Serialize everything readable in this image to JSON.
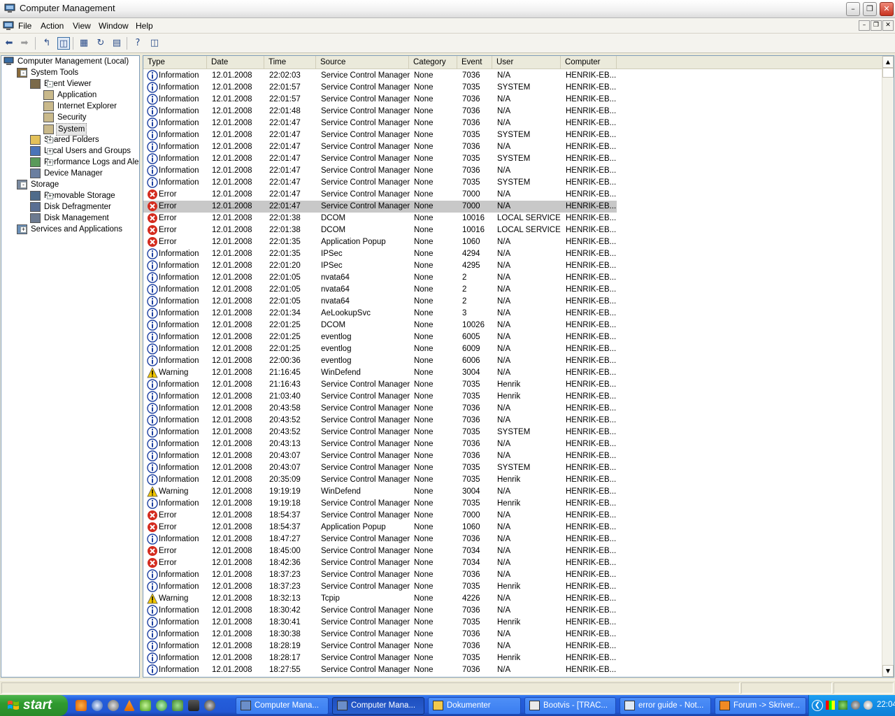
{
  "window": {
    "title": "Computer Management"
  },
  "menu": [
    "File",
    "Action",
    "View",
    "Window",
    "Help"
  ],
  "tree": {
    "root": "Computer Management (Local)",
    "items": [
      {
        "label": "System Tools",
        "level": 1,
        "exp": "-",
        "icon": "tools-icon"
      },
      {
        "label": "Event Viewer",
        "level": 2,
        "exp": "-",
        "icon": "event-viewer-icon"
      },
      {
        "label": "Application",
        "level": 3,
        "exp": "",
        "icon": "event-log-icon"
      },
      {
        "label": "Internet Explorer",
        "level": 3,
        "exp": "",
        "icon": "event-log-icon"
      },
      {
        "label": "Security",
        "level": 3,
        "exp": "",
        "icon": "event-log-icon"
      },
      {
        "label": "System",
        "level": 3,
        "exp": "",
        "icon": "event-log-icon",
        "selected": true
      },
      {
        "label": "Shared Folders",
        "level": 2,
        "exp": "+",
        "icon": "shared-folders-icon"
      },
      {
        "label": "Local Users and Groups",
        "level": 2,
        "exp": "+",
        "icon": "users-icon"
      },
      {
        "label": "Performance Logs and Alerts",
        "level": 2,
        "exp": "+",
        "icon": "performance-icon"
      },
      {
        "label": "Device Manager",
        "level": 2,
        "exp": "",
        "icon": "device-manager-icon"
      },
      {
        "label": "Storage",
        "level": 1,
        "exp": "-",
        "icon": "storage-icon"
      },
      {
        "label": "Removable Storage",
        "level": 2,
        "exp": "+",
        "icon": "removable-storage-icon"
      },
      {
        "label": "Disk Defragmenter",
        "level": 2,
        "exp": "",
        "icon": "defrag-icon"
      },
      {
        "label": "Disk Management",
        "level": 2,
        "exp": "",
        "icon": "disk-management-icon"
      },
      {
        "label": "Services and Applications",
        "level": 1,
        "exp": "+",
        "icon": "services-icon"
      }
    ]
  },
  "columns": [
    "Type",
    "Date",
    "Time",
    "Source",
    "Category",
    "Event",
    "User",
    "Computer"
  ],
  "events": [
    [
      "Information",
      "12.01.2008",
      "22:02:03",
      "Service Control Manager",
      "None",
      "7036",
      "N/A",
      "HENRIK-EB..."
    ],
    [
      "Information",
      "12.01.2008",
      "22:01:57",
      "Service Control Manager",
      "None",
      "7035",
      "SYSTEM",
      "HENRIK-EB..."
    ],
    [
      "Information",
      "12.01.2008",
      "22:01:57",
      "Service Control Manager",
      "None",
      "7036",
      "N/A",
      "HENRIK-EB..."
    ],
    [
      "Information",
      "12.01.2008",
      "22:01:48",
      "Service Control Manager",
      "None",
      "7036",
      "N/A",
      "HENRIK-EB..."
    ],
    [
      "Information",
      "12.01.2008",
      "22:01:47",
      "Service Control Manager",
      "None",
      "7036",
      "N/A",
      "HENRIK-EB..."
    ],
    [
      "Information",
      "12.01.2008",
      "22:01:47",
      "Service Control Manager",
      "None",
      "7035",
      "SYSTEM",
      "HENRIK-EB..."
    ],
    [
      "Information",
      "12.01.2008",
      "22:01:47",
      "Service Control Manager",
      "None",
      "7036",
      "N/A",
      "HENRIK-EB..."
    ],
    [
      "Information",
      "12.01.2008",
      "22:01:47",
      "Service Control Manager",
      "None",
      "7035",
      "SYSTEM",
      "HENRIK-EB..."
    ],
    [
      "Information",
      "12.01.2008",
      "22:01:47",
      "Service Control Manager",
      "None",
      "7036",
      "N/A",
      "HENRIK-EB..."
    ],
    [
      "Information",
      "12.01.2008",
      "22:01:47",
      "Service Control Manager",
      "None",
      "7035",
      "SYSTEM",
      "HENRIK-EB..."
    ],
    [
      "Error",
      "12.01.2008",
      "22:01:47",
      "Service Control Manager",
      "None",
      "7000",
      "N/A",
      "HENRIK-EB..."
    ],
    [
      "Error",
      "12.01.2008",
      "22:01:47",
      "Service Control Manager",
      "None",
      "7000",
      "N/A",
      "HENRIK-EB..."
    ],
    [
      "Error",
      "12.01.2008",
      "22:01:38",
      "DCOM",
      "None",
      "10016",
      "LOCAL SERVICE",
      "HENRIK-EB..."
    ],
    [
      "Error",
      "12.01.2008",
      "22:01:38",
      "DCOM",
      "None",
      "10016",
      "LOCAL SERVICE",
      "HENRIK-EB..."
    ],
    [
      "Error",
      "12.01.2008",
      "22:01:35",
      "Application Popup",
      "None",
      "1060",
      "N/A",
      "HENRIK-EB..."
    ],
    [
      "Information",
      "12.01.2008",
      "22:01:35",
      "IPSec",
      "None",
      "4294",
      "N/A",
      "HENRIK-EB..."
    ],
    [
      "Information",
      "12.01.2008",
      "22:01:20",
      "IPSec",
      "None",
      "4295",
      "N/A",
      "HENRIK-EB..."
    ],
    [
      "Information",
      "12.01.2008",
      "22:01:05",
      "nvata64",
      "None",
      "2",
      "N/A",
      "HENRIK-EB..."
    ],
    [
      "Information",
      "12.01.2008",
      "22:01:05",
      "nvata64",
      "None",
      "2",
      "N/A",
      "HENRIK-EB..."
    ],
    [
      "Information",
      "12.01.2008",
      "22:01:05",
      "nvata64",
      "None",
      "2",
      "N/A",
      "HENRIK-EB..."
    ],
    [
      "Information",
      "12.01.2008",
      "22:01:34",
      "AeLookupSvc",
      "None",
      "3",
      "N/A",
      "HENRIK-EB..."
    ],
    [
      "Information",
      "12.01.2008",
      "22:01:25",
      "DCOM",
      "None",
      "10026",
      "N/A",
      "HENRIK-EB..."
    ],
    [
      "Information",
      "12.01.2008",
      "22:01:25",
      "eventlog",
      "None",
      "6005",
      "N/A",
      "HENRIK-EB..."
    ],
    [
      "Information",
      "12.01.2008",
      "22:01:25",
      "eventlog",
      "None",
      "6009",
      "N/A",
      "HENRIK-EB..."
    ],
    [
      "Information",
      "12.01.2008",
      "22:00:36",
      "eventlog",
      "None",
      "6006",
      "N/A",
      "HENRIK-EB..."
    ],
    [
      "Warning",
      "12.01.2008",
      "21:16:45",
      "WinDefend",
      "None",
      "3004",
      "N/A",
      "HENRIK-EB..."
    ],
    [
      "Information",
      "12.01.2008",
      "21:16:43",
      "Service Control Manager",
      "None",
      "7035",
      "Henrik",
      "HENRIK-EB..."
    ],
    [
      "Information",
      "12.01.2008",
      "21:03:40",
      "Service Control Manager",
      "None",
      "7035",
      "Henrik",
      "HENRIK-EB..."
    ],
    [
      "Information",
      "12.01.2008",
      "20:43:58",
      "Service Control Manager",
      "None",
      "7036",
      "N/A",
      "HENRIK-EB..."
    ],
    [
      "Information",
      "12.01.2008",
      "20:43:52",
      "Service Control Manager",
      "None",
      "7036",
      "N/A",
      "HENRIK-EB..."
    ],
    [
      "Information",
      "12.01.2008",
      "20:43:52",
      "Service Control Manager",
      "None",
      "7035",
      "SYSTEM",
      "HENRIK-EB..."
    ],
    [
      "Information",
      "12.01.2008",
      "20:43:13",
      "Service Control Manager",
      "None",
      "7036",
      "N/A",
      "HENRIK-EB..."
    ],
    [
      "Information",
      "12.01.2008",
      "20:43:07",
      "Service Control Manager",
      "None",
      "7036",
      "N/A",
      "HENRIK-EB..."
    ],
    [
      "Information",
      "12.01.2008",
      "20:43:07",
      "Service Control Manager",
      "None",
      "7035",
      "SYSTEM",
      "HENRIK-EB..."
    ],
    [
      "Information",
      "12.01.2008",
      "20:35:09",
      "Service Control Manager",
      "None",
      "7035",
      "Henrik",
      "HENRIK-EB..."
    ],
    [
      "Warning",
      "12.01.2008",
      "19:19:19",
      "WinDefend",
      "None",
      "3004",
      "N/A",
      "HENRIK-EB..."
    ],
    [
      "Information",
      "12.01.2008",
      "19:19:18",
      "Service Control Manager",
      "None",
      "7035",
      "Henrik",
      "HENRIK-EB..."
    ],
    [
      "Error",
      "12.01.2008",
      "18:54:37",
      "Service Control Manager",
      "None",
      "7000",
      "N/A",
      "HENRIK-EB..."
    ],
    [
      "Error",
      "12.01.2008",
      "18:54:37",
      "Application Popup",
      "None",
      "1060",
      "N/A",
      "HENRIK-EB..."
    ],
    [
      "Information",
      "12.01.2008",
      "18:47:27",
      "Service Control Manager",
      "None",
      "7036",
      "N/A",
      "HENRIK-EB..."
    ],
    [
      "Error",
      "12.01.2008",
      "18:45:00",
      "Service Control Manager",
      "None",
      "7034",
      "N/A",
      "HENRIK-EB..."
    ],
    [
      "Error",
      "12.01.2008",
      "18:42:36",
      "Service Control Manager",
      "None",
      "7034",
      "N/A",
      "HENRIK-EB..."
    ],
    [
      "Information",
      "12.01.2008",
      "18:37:23",
      "Service Control Manager",
      "None",
      "7036",
      "N/A",
      "HENRIK-EB..."
    ],
    [
      "Information",
      "12.01.2008",
      "18:37:23",
      "Service Control Manager",
      "None",
      "7035",
      "Henrik",
      "HENRIK-EB..."
    ],
    [
      "Warning",
      "12.01.2008",
      "18:32:13",
      "Tcpip",
      "None",
      "4226",
      "N/A",
      "HENRIK-EB..."
    ],
    [
      "Information",
      "12.01.2008",
      "18:30:42",
      "Service Control Manager",
      "None",
      "7036",
      "N/A",
      "HENRIK-EB..."
    ],
    [
      "Information",
      "12.01.2008",
      "18:30:41",
      "Service Control Manager",
      "None",
      "7035",
      "Henrik",
      "HENRIK-EB..."
    ],
    [
      "Information",
      "12.01.2008",
      "18:30:38",
      "Service Control Manager",
      "None",
      "7036",
      "N/A",
      "HENRIK-EB..."
    ],
    [
      "Information",
      "12.01.2008",
      "18:28:19",
      "Service Control Manager",
      "None",
      "7036",
      "N/A",
      "HENRIK-EB..."
    ],
    [
      "Information",
      "12.01.2008",
      "18:28:17",
      "Service Control Manager",
      "None",
      "7035",
      "Henrik",
      "HENRIK-EB..."
    ],
    [
      "Information",
      "12.01.2008",
      "18:27:55",
      "Service Control Manager",
      "None",
      "7036",
      "N/A",
      "HENRIK-EB..."
    ]
  ],
  "selected_row": 11,
  "taskbar": {
    "start": "start",
    "tasks": [
      {
        "label": "Computer Mana...",
        "icon": "computer-management-icon",
        "active": false
      },
      {
        "label": "Computer Mana...",
        "icon": "computer-management-icon",
        "active": true
      },
      {
        "label": "Dokumenter",
        "icon": "folder-icon",
        "active": false
      },
      {
        "label": "Bootvis - [TRAC...",
        "icon": "bootvis-icon",
        "active": false
      },
      {
        "label": "error guide - Not...",
        "icon": "notepad-icon",
        "active": false
      },
      {
        "label": "Forum -> Skriver...",
        "icon": "firefox-icon",
        "active": false
      }
    ],
    "clock": "22:04"
  },
  "colors": {
    "info": "#1c3fa0",
    "error": "#d42b1e",
    "warning": "#f2c700",
    "selected_row": "#c8c8c8"
  }
}
